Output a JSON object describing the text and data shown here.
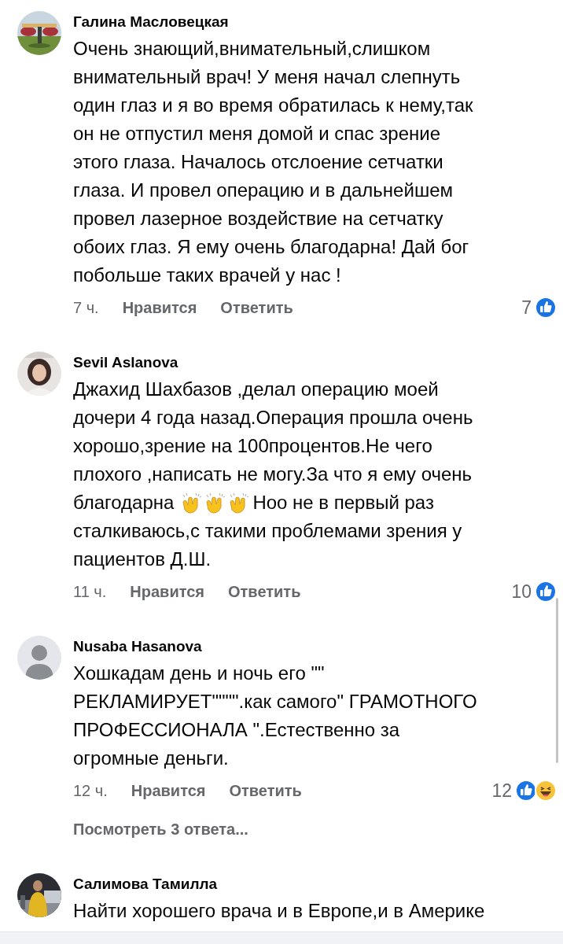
{
  "comments": [
    {
      "author": "Галина Масловецкая",
      "avatar": {
        "kind": "picture"
      },
      "body": [
        {
          "parts": [
            {
              "kind": "text",
              "text": "Очень знающий,внимательный,слишком\nвнимательный врач! У меня начал слепнуть\nодин глаз и я во время обратилась к нему,так\nон не отпустил меня домой и спас зрение\nэтого глаза. Началось отслоение сетчатки\nглаза. И провел операцию и в дальнейшем\nпровел лазерное воздействие на сетчатку\nобоих глаз. Я ему очень благодарна! Дай бог\nпобольше таких врачей у нас !"
            }
          ]
        }
      ],
      "time": "7 ч.",
      "like": "Нравится",
      "reply": "Ответить",
      "reaction_count": "7",
      "reactions": [
        {
          "kind": "like"
        }
      ]
    },
    {
      "author": "Sevil Aslanova",
      "avatar": {
        "kind": "picture"
      },
      "body": [
        {
          "parts": [
            {
              "kind": "text",
              "text": "Джахид Шахбазов ,делал операцию моей\nдочери 4 года назад.Операция прошла очень\nхорошо,зрение на 100процентов.Не чего\nплохого ,написать не могу.За что я ему очень"
            }
          ]
        },
        {
          "parts": [
            {
              "kind": "text",
              "text": "благодарна"
            },
            {
              "kind": "clap"
            },
            {
              "kind": "clap"
            },
            {
              "kind": "clap"
            },
            {
              "kind": "text",
              "text": "Ноо не в первый раз"
            }
          ]
        },
        {
          "parts": [
            {
              "kind": "text",
              "text": "сталкиваюсь,с такими проблемами  зрения у\nпациентов Д.Ш."
            }
          ]
        }
      ],
      "time": "11 ч.",
      "like": "Нравится",
      "reply": "Ответить",
      "reaction_count": "10",
      "reactions": [
        {
          "kind": "like"
        }
      ]
    },
    {
      "author": "Nusaba Hasanova",
      "avatar": {
        "kind": "silhouette"
      },
      "body": [
        {
          "parts": [
            {
              "kind": "text",
              "text": "Хошкадам день и ночь его \"\"\nРЕКЛАМИРУЕТ\"\"\"\".как самого\" ГРАМОТНОГО\nПРОФЕССИОНАЛА \".Естественно за\nогромные деньги."
            }
          ]
        }
      ],
      "time": "12 ч.",
      "like": "Нравится",
      "reply": "Ответить",
      "reaction_count": "12",
      "reactions": [
        {
          "kind": "like"
        },
        {
          "kind": "haha"
        }
      ],
      "replies_link": "Посмотреть 3 ответа..."
    },
    {
      "author": "Салимова Тамилла",
      "avatar": {
        "kind": "picture"
      },
      "body": [
        {
          "parts": [
            {
              "kind": "text",
              "text": "Найти хорошего врача и в Европе,и в Америке"
            }
          ]
        }
      ]
    }
  ]
}
